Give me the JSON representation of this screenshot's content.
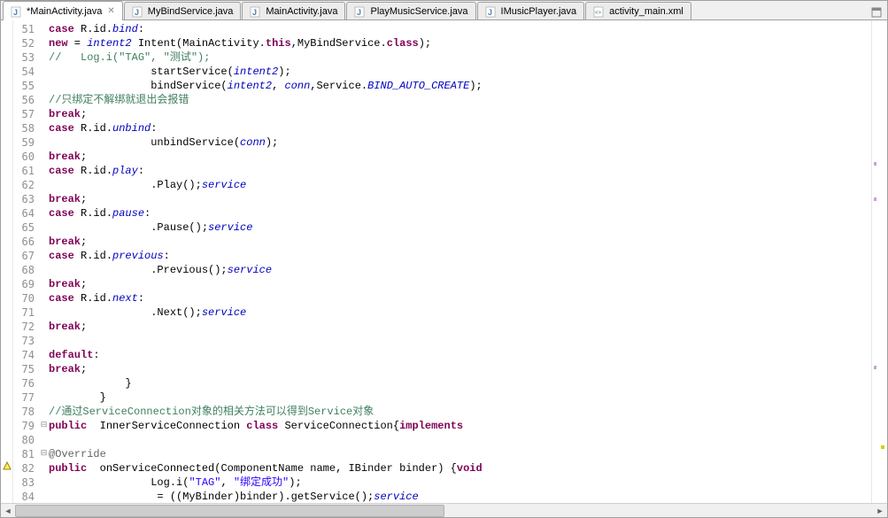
{
  "tabs": [
    {
      "label": "*MainActivity.java",
      "icon": "java",
      "active": true,
      "closable": true
    },
    {
      "label": "MyBindService.java",
      "icon": "java",
      "active": false
    },
    {
      "label": "MainActivity.java",
      "icon": "java",
      "active": false
    },
    {
      "label": "PlayMusicService.java",
      "icon": "java",
      "active": false
    },
    {
      "label": "IMusicPlayer.java",
      "icon": "java",
      "active": false
    },
    {
      "label": "activity_main.xml",
      "icon": "xml",
      "active": false
    }
  ],
  "gutter": {
    "start": 51,
    "end": 84,
    "highlighted": 54,
    "collapse_markers": [
      {
        "line": 79,
        "type": "minus"
      },
      {
        "line": 81,
        "type": "minus"
      }
    ],
    "warn_marker_line": 82,
    "change_markers": [
      60,
      63,
      75
    ]
  },
  "code": {
    "l51": {
      "indent": "            ",
      "kw1": "case",
      "txt1": " R.id.",
      "fld1": "bind",
      "txt2": ":"
    },
    "l52": {
      "indent": "                ",
      "fld1": "intent2",
      "txt1": " = ",
      "kw1": "new",
      "txt2": " Intent(MainActivity.",
      "kw2": "this",
      "txt3": ",MyBindService.",
      "kw3": "class",
      "txt4": ");"
    },
    "l53": {
      "indent": "        ",
      "cmt": "//   Log.i(\"TAG\", \"测试\");"
    },
    "l54": {
      "indent": "                ",
      "txt1": "startService(",
      "fld1": "intent2",
      "txt2": ");"
    },
    "l55": {
      "indent": "                ",
      "txt1": "bindService(",
      "fld1": "intent2",
      "txt2": ", ",
      "fld2": "conn",
      "txt3": ",Service.",
      "sfld": "BIND_AUTO_CREATE",
      "txt4": ");"
    },
    "l56": {
      "indent": "                ",
      "cmt": "//只绑定不解绑就退出会报错"
    },
    "l57": {
      "indent": "                ",
      "kw1": "break",
      "txt1": ";"
    },
    "l58": {
      "indent": "            ",
      "kw1": "case",
      "txt1": " R.id.",
      "fld1": "unbind",
      "txt2": ":"
    },
    "l59": {
      "indent": "                ",
      "txt1": "unbindService(",
      "fld1": "conn",
      "txt2": ");"
    },
    "l60": {
      "indent": "                ",
      "kw1": "break",
      "txt1": ";"
    },
    "l61": {
      "indent": "            ",
      "kw1": "case",
      "txt1": " R.id.",
      "fld1": "play",
      "txt2": ":"
    },
    "l62": {
      "indent": "                ",
      "fld1": "service",
      "txt1": ".Play();"
    },
    "l63": {
      "indent": "                ",
      "kw1": "break",
      "txt1": ";"
    },
    "l64": {
      "indent": "            ",
      "kw1": "case",
      "txt1": " R.id.",
      "fld1": "pause",
      "txt2": ":"
    },
    "l65": {
      "indent": "                ",
      "fld1": "service",
      "txt1": ".Pause();"
    },
    "l66": {
      "indent": "                ",
      "kw1": "break",
      "txt1": ";"
    },
    "l67": {
      "indent": "            ",
      "kw1": "case",
      "txt1": " R.id.",
      "fld1": "previous",
      "txt2": ":"
    },
    "l68": {
      "indent": "                ",
      "fld1": "service",
      "txt1": ".Previous();"
    },
    "l69": {
      "indent": "                ",
      "kw1": "break",
      "txt1": ";"
    },
    "l70": {
      "indent": "            ",
      "kw1": "case",
      "txt1": " R.id.",
      "fld1": "next",
      "txt2": ":"
    },
    "l71": {
      "indent": "                ",
      "fld1": "service",
      "txt1": ".Next();"
    },
    "l72": {
      "indent": "                ",
      "kw1": "break",
      "txt1": ";"
    },
    "l73": {
      "indent": ""
    },
    "l74": {
      "indent": "            ",
      "kw1": "default",
      "txt1": ":"
    },
    "l75": {
      "indent": "                ",
      "kw1": "break",
      "txt1": ";"
    },
    "l76": {
      "indent": "            ",
      "txt1": "}"
    },
    "l77": {
      "indent": "        ",
      "txt1": "}"
    },
    "l78": {
      "indent": "        ",
      "cmt": "//通过ServiceConnection对象的相关方法可以得到Service对象"
    },
    "l79": {
      "indent": "        ",
      "kw1": "public",
      "txt1": " ",
      "kw2": "class",
      "txt2": " InnerServiceConnection ",
      "kw3": "implements",
      "txt3": " ServiceConnection{"
    },
    "l80": {
      "indent": ""
    },
    "l81": {
      "indent": "            ",
      "ann": "@Override"
    },
    "l82": {
      "indent": "            ",
      "kw1": "public",
      "txt1": " ",
      "kw2": "void",
      "txt2": " onServiceConnected(ComponentName name, IBinder binder) {"
    },
    "l83": {
      "indent": "                ",
      "txt1": "Log.i(",
      "str1": "\"TAG\"",
      "txt2": ", ",
      "str2": "\"绑定成功\"",
      "txt3": ");"
    },
    "l84": {
      "indent": "                ",
      "fld1": "service",
      "txt1": " = ((MyBinder)binder).getService();"
    }
  }
}
